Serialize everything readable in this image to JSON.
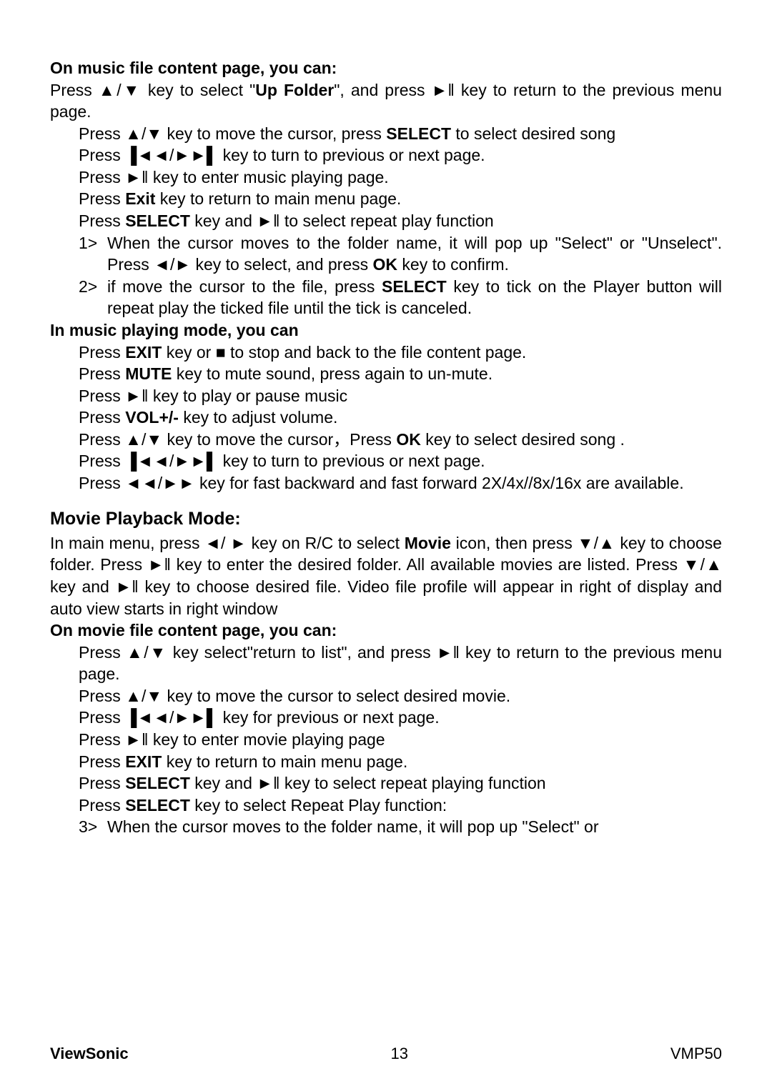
{
  "music_page_heading": "On music file content page, you can:",
  "music_page_intro": "Press ▲/▼ key to select \"Up Folder\", and press ►‖ key to return to the previous menu page.",
  "music_page_items": [
    "Press ▲/▼ key to move the cursor, press SELECT to select desired song",
    "Press ▐◄◄/►►▌ key to turn to previous or next page.",
    "Press ►‖ key to enter music playing page.",
    "Press Exit key to return to main menu page.",
    "Press SELECT key and ►‖ to select repeat play function"
  ],
  "music_page_numbered": [
    {
      "n": "1>",
      "t": "When the cursor moves to the folder name, it will pop up \"Select\" or \"Unselect\". Press ◄/► key to select, and press OK key to confirm."
    },
    {
      "n": "2>",
      "t": "if move the cursor to the file, press SELECT key to tick on the Player button will repeat play the ticked file until the tick is canceled."
    }
  ],
  "music_play_heading": "In music playing mode, you can",
  "music_play_items": [
    "Press EXIT key or ■ to stop and back to the file content page.",
    "Press MUTE key to mute sound, press again to un-mute.",
    "Press ►‖ key to play or pause music",
    "Press VOL+/- key to adjust volume.",
    "Press ▲/▼ key to move the cursor，Press OK key to select desired song .",
    "Press ▐◄◄/►►▌ key to turn to previous or next page.",
    "Press ◄◄/►► key for fast backward and fast forward 2X/4x//8x/16x are available."
  ],
  "movie_heading": "Movie Playback Mode:",
  "movie_intro": "In main menu, press ◄/ ► key on R/C to select Movie icon, then press ▼/▲ key to choose folder. Press ►‖ key to enter the desired folder. All available movies are listed. Press ▼/▲ key and ►‖ key to choose desired file. Video file profile will appear in right of display and auto view starts in right window",
  "movie_page_heading": "On movie file content page, you can:",
  "movie_page_items": [
    "Press ▲/▼ key select\"return to list\", and press ►‖ key to return to the previous menu page.",
    "Press ▲/▼ key to move the cursor to select desired movie.",
    "Press ▐◄◄/►►▌ key for previous or next page.",
    "Press ►‖ key to enter movie playing page",
    "Press EXIT key to return to main menu page.",
    "Press SELECT key and ►‖ key to select repeat playing function",
    "Press SELECT key to select Repeat Play function:"
  ],
  "movie_numbered": [
    {
      "n": "3>",
      "t": "When the cursor moves to the folder name, it will pop up \"Select\" or"
    }
  ],
  "footer": {
    "brand": "ViewSonic",
    "page": "13",
    "model": "VMP50"
  }
}
